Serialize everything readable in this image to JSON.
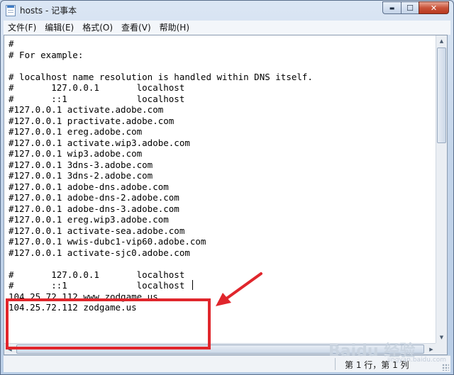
{
  "window": {
    "title": "hosts - 记事本",
    "min_glyph": "▬",
    "max_glyph": "☐",
    "close_glyph": "✕"
  },
  "menu": [
    "文件(F)",
    "编辑(E)",
    "格式(O)",
    "查看(V)",
    "帮助(H)"
  ],
  "editor": {
    "lines": [
      "#",
      "# For example:",
      "",
      "# localhost name resolution is handled within DNS itself.",
      "#\t127.0.0.1       localhost",
      "#\t::1             localhost",
      "#127.0.0.1 activate.adobe.com",
      "#127.0.0.1 practivate.adobe.com",
      "#127.0.0.1 ereg.adobe.com",
      "#127.0.0.1 activate.wip3.adobe.com",
      "#127.0.0.1 wip3.adobe.com",
      "#127.0.0.1 3dns-3.adobe.com",
      "#127.0.0.1 3dns-2.adobe.com",
      "#127.0.0.1 adobe-dns.adobe.com",
      "#127.0.0.1 adobe-dns-2.adobe.com",
      "#127.0.0.1 adobe-dns-3.adobe.com",
      "#127.0.0.1 ereg.wip3.adobe.com",
      "#127.0.0.1 activate-sea.adobe.com",
      "#127.0.0.1 wwis-dubc1-vip60.adobe.com",
      "#127.0.0.1 activate-sjc0.adobe.com",
      "",
      "#\t127.0.0.1       localhost",
      "#\t::1             localhost",
      "104.25.72.112 www.zodgame.us",
      "104.25.72.112 zodgame.us"
    ]
  },
  "status": {
    "position": "第 1 行，第 1 列"
  },
  "watermark": {
    "text": "Baidu 经验",
    "sub": "jingyan.baidu.com"
  }
}
